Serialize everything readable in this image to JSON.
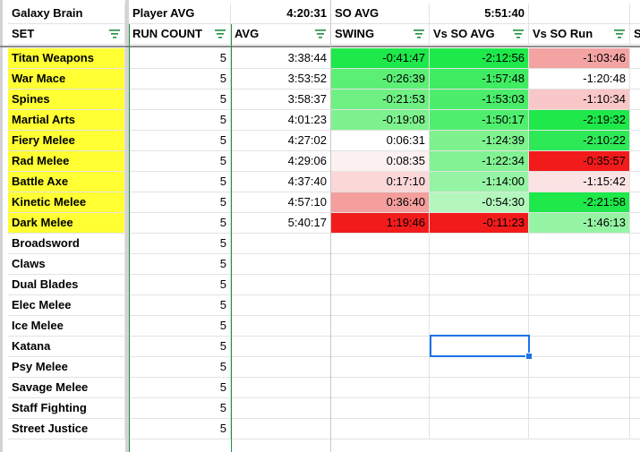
{
  "header_row": {
    "a": "Galaxy Brain",
    "b": "Player AVG",
    "c": "4:20:31",
    "d": "SO AVG",
    "e": "5:51:40"
  },
  "columns": [
    {
      "label": "SET",
      "filter": true
    },
    {
      "label": "RUN COUNT",
      "filter": true
    },
    {
      "label": "AVG",
      "filter": true
    },
    {
      "label": "SWING",
      "filter": true
    },
    {
      "label": "Vs SO AVG",
      "filter": true
    },
    {
      "label": "Vs SO Run",
      "filter": true
    },
    {
      "label": "S",
      "filter": false
    }
  ],
  "colors": {
    "highlight_yellow": "#ffff33",
    "selection_blue": "#1a73e8",
    "filter_green": "#1e8e3e"
  },
  "rows": [
    {
      "set": "Titan Weapons",
      "count": "5",
      "avg": "3:38:44",
      "swing": "-0:41:47",
      "vs_avg": "-2:12:56",
      "vs_run": "-1:03:46",
      "c_swing": "#1ee84a",
      "c_vs_avg": "#1ee84a",
      "c_vs_run": "#f4a3a3"
    },
    {
      "set": "War Mace",
      "count": "5",
      "avg": "3:53:52",
      "swing": "-0:26:39",
      "vs_avg": "-1:57:48",
      "vs_run": "-1:20:48",
      "c_swing": "#5cef76",
      "c_vs_avg": "#3fec62",
      "c_vs_run": "#ffffff"
    },
    {
      "set": "Spines",
      "count": "5",
      "avg": "3:58:37",
      "swing": "-0:21:53",
      "vs_avg": "-1:53:03",
      "vs_run": "-1:10:34",
      "c_swing": "#6ff083",
      "c_vs_avg": "#4bed6b",
      "c_vs_run": "#f9c7c7"
    },
    {
      "set": "Martial Arts",
      "count": "5",
      "avg": "4:01:23",
      "swing": "-0:19:08",
      "vs_avg": "-1:50:17",
      "vs_run": "-2:19:32",
      "c_swing": "#7df28e",
      "c_vs_avg": "#50ee6f",
      "c_vs_run": "#1ee84a"
    },
    {
      "set": "Fiery Melee",
      "count": "5",
      "avg": "4:27:02",
      "swing": "0:06:31",
      "vs_avg": "-1:24:39",
      "vs_run": "-2:10:22",
      "c_swing": "#ffffff",
      "c_vs_avg": "#7df28e",
      "c_vs_run": "#2ee956"
    },
    {
      "set": "Rad Melee",
      "count": "5",
      "avg": "4:29:06",
      "swing": "0:08:35",
      "vs_avg": "-1:22:34",
      "vs_run": "-0:35:57",
      "c_swing": "#fdf0f0",
      "c_vs_avg": "#82f292",
      "c_vs_run": "#f21b1b"
    },
    {
      "set": "Battle Axe",
      "count": "5",
      "avg": "4:37:40",
      "swing": "0:17:10",
      "vs_avg": "-1:14:00",
      "vs_run": "-1:15:42",
      "c_swing": "#fbd7d7",
      "c_vs_avg": "#95f4a3",
      "c_vs_run": "#fce3e3"
    },
    {
      "set": "Kinetic Melee",
      "count": "5",
      "avg": "4:57:10",
      "swing": "0:36:40",
      "vs_avg": "-0:54:30",
      "vs_run": "-2:21:58",
      "c_swing": "#f59e9e",
      "c_vs_avg": "#b4f7bd",
      "c_vs_run": "#1ee84a"
    },
    {
      "set": "Dark Melee",
      "count": "5",
      "avg": "5:40:17",
      "swing": "1:19:46",
      "vs_avg": "-0:11:23",
      "vs_run": "-1:46:13",
      "c_swing": "#f21b1b",
      "c_vs_avg": "#f21b1b",
      "c_vs_run": "#95f4a3"
    },
    {
      "set": "Broadsword",
      "count": "5"
    },
    {
      "set": "Claws",
      "count": "5"
    },
    {
      "set": "Dual Blades",
      "count": "5"
    },
    {
      "set": "Elec Melee",
      "count": "5"
    },
    {
      "set": "Ice Melee",
      "count": "5"
    },
    {
      "set": "Katana",
      "count": "5"
    },
    {
      "set": "Psy Melee",
      "count": "5"
    },
    {
      "set": "Savage Melee",
      "count": "5"
    },
    {
      "set": "Staff Fighting",
      "count": "5"
    },
    {
      "set": "Street Justice",
      "count": "5"
    }
  ]
}
